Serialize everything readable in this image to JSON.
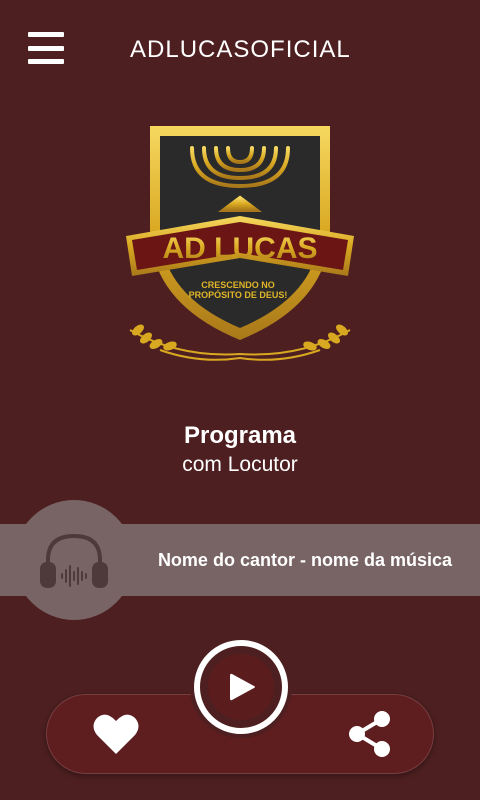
{
  "header": {
    "title": "ADLUCASOFICIAL",
    "menu_icon": "hamburger-menu-icon"
  },
  "logo": {
    "name": "AD LUCAS",
    "tagline_line1": "CRESCENDO NO",
    "tagline_line2": "PROPÓSITO DE DEUS!",
    "colors": {
      "gold": "#e0b628",
      "shield": "#2a2a2a",
      "banner": "#6b1515"
    }
  },
  "program": {
    "name": "Programa",
    "host": "com Locutor"
  },
  "now_playing": {
    "track": "Nome do cantor - nome da música",
    "cover_icon": "headphones-icon"
  },
  "controls": {
    "like_icon": "heart-icon",
    "play_icon": "play-icon",
    "share_icon": "share-icon"
  },
  "colors": {
    "background": "#4d1f20",
    "bar": "#786465",
    "control_pill": "#5e1d1e",
    "text": "#ffffff"
  }
}
